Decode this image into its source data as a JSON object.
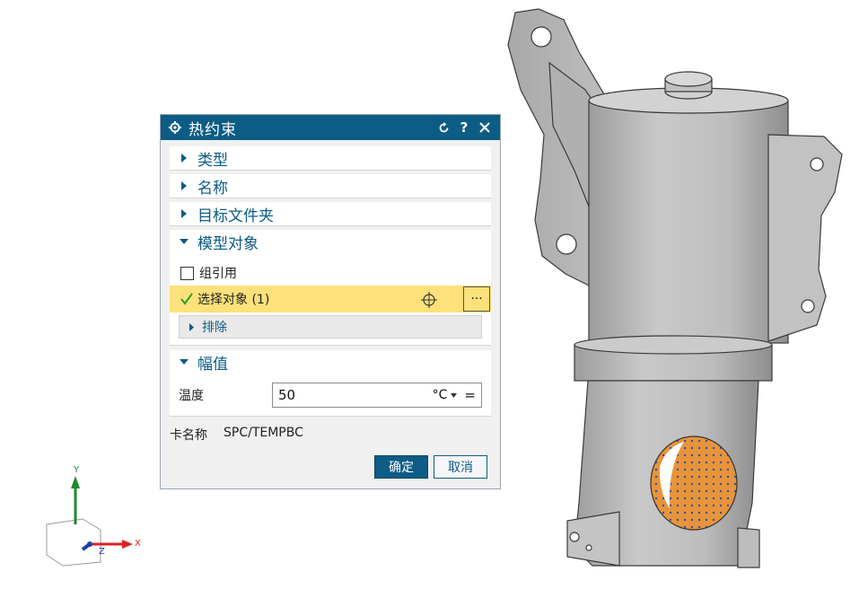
{
  "dialog": {
    "title": "热约束",
    "sections": {
      "type": "类型",
      "name": "名称",
      "target_folder": "目标文件夹",
      "model_objects": "模型对象",
      "magnitude": "幅值"
    },
    "group_reference_label": "组引用",
    "select_objects_label": "选择对象 (1)",
    "more_label": "···",
    "exclude_label": "排除",
    "temperature_label": "温度",
    "temperature_value": "50",
    "temperature_unit": "°C",
    "card_name_key": "卡名称",
    "card_name_value": "SPC/TEMPBC",
    "ok_label": "确定",
    "cancel_label": "取消"
  },
  "triad": {
    "x_label": "X",
    "y_label": "Y",
    "z_label": "Z"
  },
  "colors": {
    "title_bar": "#0d5c86",
    "selection_highlight": "#fde17a",
    "accent_text": "#0b5c86",
    "model_gray": "#b9b9b9",
    "bore_orange": "#e8943a"
  }
}
